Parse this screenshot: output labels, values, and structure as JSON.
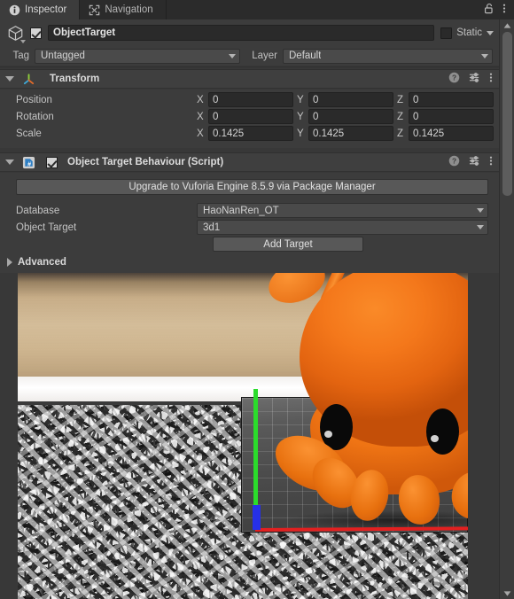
{
  "window": {
    "tabs": [
      {
        "label": "Inspector",
        "icon": "info-icon",
        "active": true
      },
      {
        "label": "Navigation",
        "icon": "navigation-icon",
        "active": false
      }
    ],
    "lock_icon": "lock-open-icon",
    "menu_icon": "kebab-menu-icon"
  },
  "gameobject": {
    "icon": "cube-icon",
    "enabled": true,
    "name": "ObjectTarget",
    "static_label": "Static",
    "static_checked": false,
    "tag_label": "Tag",
    "tag_value": "Untagged",
    "layer_label": "Layer",
    "layer_value": "Default"
  },
  "transform": {
    "title": "Transform",
    "icon": "transform-gizmo-icon",
    "expanded": true,
    "help_icon": "help-icon",
    "preset_icon": "preset-icon",
    "menu_icon": "kebab-menu-icon",
    "rows": [
      {
        "label": "Position",
        "x": "0",
        "y": "0",
        "z": "0"
      },
      {
        "label": "Rotation",
        "x": "0",
        "y": "0",
        "z": "0"
      },
      {
        "label": "Scale",
        "x": "0.1425",
        "y": "0.1425",
        "z": "0.1425"
      }
    ],
    "axis_labels": {
      "x": "X",
      "y": "Y",
      "z": "Z"
    }
  },
  "script_component": {
    "title": "Object Target Behaviour (Script)",
    "icon": "csharp-script-icon",
    "enabled": true,
    "expanded": true,
    "help_icon": "help-icon",
    "preset_icon": "preset-icon",
    "menu_icon": "kebab-menu-icon",
    "upgrade_button": "Upgrade to Vuforia Engine 8.5.9 via Package Manager",
    "database_label": "Database",
    "database_value": "HaoNanRen_OT",
    "object_target_label": "Object Target",
    "object_target_value": "3d1",
    "add_target_button": "Add Target",
    "advanced_label": "Advanced",
    "advanced_expanded": false
  },
  "preview": {
    "name": "object-target-preview-image",
    "description": "Photo of an orange toy figure on a Vuforia object scanning mat",
    "axes": {
      "x_color": "#e32020",
      "y_color": "#2bdc2b",
      "z_color": "#2630e8"
    }
  },
  "scrollbar": {
    "up_icon": "scroll-up-arrow-icon",
    "down_icon": "scroll-down-arrow-icon"
  },
  "colors": {
    "window_bg": "#383838",
    "panel_bg": "#3c3c3c",
    "tabbar_bg": "#2b2b2b",
    "field_bg": "#2a2a2a",
    "button_bg": "#585858",
    "text": "#c8c8c8"
  }
}
